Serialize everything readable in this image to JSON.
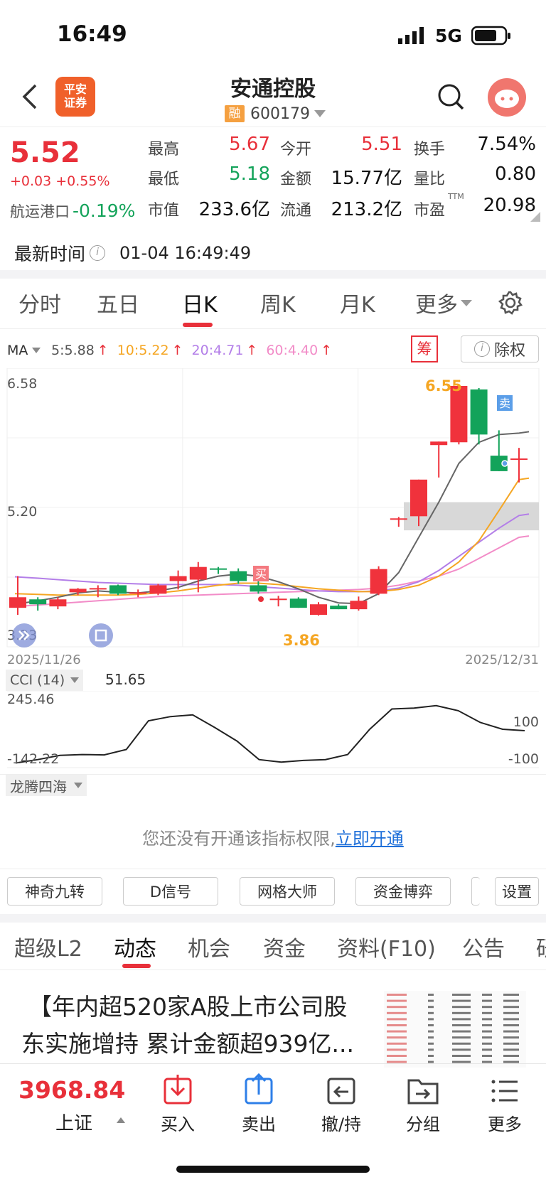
{
  "status_bar": {
    "time": "16:49",
    "network": "5G"
  },
  "header": {
    "title": "安通控股",
    "code": "600179",
    "margin_badge": "融",
    "broker_logo": "平安证券"
  },
  "quote": {
    "price": "5.52",
    "change": "+0.03 +0.55%",
    "sector_name": "航运港口",
    "sector_change": "-0.19%",
    "grid": [
      {
        "label": "最高",
        "value": "5.67",
        "color": "red"
      },
      {
        "label": "今开",
        "value": "5.51",
        "color": "red"
      },
      {
        "label": "换手",
        "value": "7.54%",
        "color": "dark"
      },
      {
        "label": "最低",
        "value": "5.18",
        "color": "green"
      },
      {
        "label": "金额",
        "value": "15.77亿",
        "color": "dark"
      },
      {
        "label": "量比",
        "value": "0.80",
        "color": "dark"
      },
      {
        "label": "市值",
        "value": "233.6亿",
        "color": "dark"
      },
      {
        "label": "流通",
        "value": "213.2亿",
        "color": "dark"
      },
      {
        "label": "市盈",
        "value": "20.98",
        "color": "dark",
        "sup": "TTM"
      }
    ],
    "update_label": "最新时间",
    "update_time": "01-04 16:49:49"
  },
  "chart_tabs": {
    "items": [
      "分时",
      "五日",
      "日K",
      "周K",
      "月K",
      "更多"
    ],
    "active": "日K"
  },
  "ma_bar": {
    "label": "MA",
    "ma5": "5:5.88",
    "ma10": "10:5.22",
    "ma20": "20:4.71",
    "ma60": "60:4.40",
    "chip_button": "筹",
    "exright_button": "除权"
  },
  "chart_data": {
    "type": "candlestick",
    "y_max_label": "6.58",
    "y_mid_label": "5.20",
    "y_min_label": "3.23",
    "high_marker": "6.55",
    "low_marker": "3.86",
    "buy_marker": "买",
    "sell_marker": "卖",
    "start_date": "2025/11/26",
    "end_date": "2025/12/31",
    "ylim": [
      3.23,
      6.58
    ],
    "colors": {
      "up": "#f0323c",
      "down": "#13a35a",
      "ma5": "#666666",
      "ma10": "#f5a623",
      "ma20": "#b37ee8",
      "ma60": "#f28cc8"
    },
    "candles": [
      {
        "o": 3.4,
        "h": 3.85,
        "l": 3.3,
        "c": 3.55
      },
      {
        "o": 3.52,
        "h": 3.55,
        "l": 3.36,
        "c": 3.45
      },
      {
        "o": 3.42,
        "h": 3.55,
        "l": 3.38,
        "c": 3.52
      },
      {
        "o": 3.62,
        "h": 3.68,
        "l": 3.58,
        "c": 3.67
      },
      {
        "o": 3.67,
        "h": 3.72,
        "l": 3.55,
        "c": 3.68
      },
      {
        "o": 3.72,
        "h": 3.73,
        "l": 3.58,
        "c": 3.6
      },
      {
        "o": 3.6,
        "h": 3.66,
        "l": 3.55,
        "c": 3.62
      },
      {
        "o": 3.6,
        "h": 3.74,
        "l": 3.58,
        "c": 3.72
      },
      {
        "o": 3.78,
        "h": 3.93,
        "l": 3.66,
        "c": 3.85
      },
      {
        "o": 3.8,
        "h": 4.05,
        "l": 3.62,
        "c": 3.98
      },
      {
        "o": 3.96,
        "h": 3.98,
        "l": 3.88,
        "c": 3.95
      },
      {
        "o": 3.92,
        "h": 3.96,
        "l": 3.74,
        "c": 3.78
      },
      {
        "o": 3.72,
        "h": 3.78,
        "l": 3.6,
        "c": 3.63
      },
      {
        "o": 3.53,
        "h": 3.57,
        "l": 3.42,
        "c": 3.53
      },
      {
        "o": 3.53,
        "h": 3.55,
        "l": 3.4,
        "c": 3.4
      },
      {
        "o": 3.3,
        "h": 3.48,
        "l": 3.29,
        "c": 3.45
      },
      {
        "o": 3.43,
        "h": 3.45,
        "l": 3.38,
        "c": 3.38
      },
      {
        "o": 3.38,
        "h": 3.56,
        "l": 3.36,
        "c": 3.5
      },
      {
        "o": 3.6,
        "h": 3.99,
        "l": 3.58,
        "c": 3.95
      },
      {
        "o": 4.67,
        "h": 4.69,
        "l": 4.55,
        "c": 4.67
      },
      {
        "o": 4.7,
        "h": 5.22,
        "l": 4.56,
        "c": 5.22
      },
      {
        "o": 5.71,
        "h": 5.76,
        "l": 5.25,
        "c": 5.76
      },
      {
        "o": 5.75,
        "h": 6.55,
        "l": 5.72,
        "c": 6.55
      },
      {
        "o": 6.5,
        "h": 6.52,
        "l": 5.72,
        "c": 5.86
      },
      {
        "o": 5.56,
        "h": 5.92,
        "l": 5.34,
        "c": 5.34
      },
      {
        "o": 5.51,
        "h": 5.67,
        "l": 5.18,
        "c": 5.52
      }
    ],
    "ma5": [
      3.45,
      3.5,
      3.55,
      3.61,
      3.64,
      3.62,
      3.61,
      3.64,
      3.69,
      3.78,
      3.85,
      3.88,
      3.85,
      3.77,
      3.67,
      3.55,
      3.47,
      3.46,
      3.6,
      3.9,
      4.4,
      4.9,
      5.45,
      5.75,
      5.86,
      5.88
    ],
    "ma10": [
      3.6,
      3.59,
      3.58,
      3.58,
      3.58,
      3.58,
      3.59,
      3.61,
      3.64,
      3.68,
      3.72,
      3.75,
      3.75,
      3.73,
      3.7,
      3.67,
      3.65,
      3.63,
      3.63,
      3.66,
      3.72,
      3.85,
      4.05,
      4.35,
      4.78,
      5.22
    ],
    "ma20": [
      3.84,
      3.82,
      3.8,
      3.78,
      3.76,
      3.75,
      3.74,
      3.73,
      3.73,
      3.73,
      3.73,
      3.72,
      3.7,
      3.68,
      3.66,
      3.64,
      3.63,
      3.63,
      3.64,
      3.68,
      3.77,
      3.93,
      4.13,
      4.33,
      4.53,
      4.71
    ],
    "ma60": [
      3.42,
      3.44,
      3.46,
      3.48,
      3.5,
      3.52,
      3.54,
      3.56,
      3.57,
      3.58,
      3.59,
      3.6,
      3.61,
      3.62,
      3.63,
      3.64,
      3.65,
      3.66,
      3.68,
      3.72,
      3.78,
      3.85,
      3.95,
      4.1,
      4.25,
      4.4
    ]
  },
  "cci": {
    "label": "CCI (14)",
    "value": "51.65",
    "max_label": "245.46",
    "min_label": "-142.22",
    "upper_ref": "100",
    "lower_ref": "-100",
    "ylim": [
      -142.22,
      245.46
    ],
    "values": [
      -140,
      -120,
      -95,
      -90,
      -92,
      -60,
      110,
      135,
      145,
      70,
      -10,
      -120,
      -135,
      -125,
      -120,
      -90,
      60,
      180,
      185,
      200,
      170,
      100,
      60,
      51.65
    ]
  },
  "indicator_locked": {
    "selector": "龙腾四海",
    "notice": "您还没有开通该指标权限,",
    "link": "立即开通"
  },
  "tool_buttons": [
    "神奇九转",
    "D信号",
    "网格大师",
    "资金博弈",
    "设置"
  ],
  "news_tabs": {
    "items": [
      "超级L2",
      "动态",
      "机会",
      "资金",
      "资料(F10)",
      "公告",
      "研"
    ],
    "active": "动态"
  },
  "news": {
    "headline_line1": "【年内超520家A股上市公司股",
    "headline_line2": "东实施增持 累计金额超939亿..."
  },
  "bottom_bar": {
    "index_value": "3968.84",
    "index_name": "上证",
    "actions": [
      {
        "label": "买入",
        "icon": "buy-icon"
      },
      {
        "label": "卖出",
        "icon": "sell-icon"
      },
      {
        "label": "撤/持",
        "icon": "cancel-hold-icon"
      },
      {
        "label": "分组",
        "icon": "group-icon"
      },
      {
        "label": "更多",
        "icon": "more-icon"
      }
    ]
  }
}
